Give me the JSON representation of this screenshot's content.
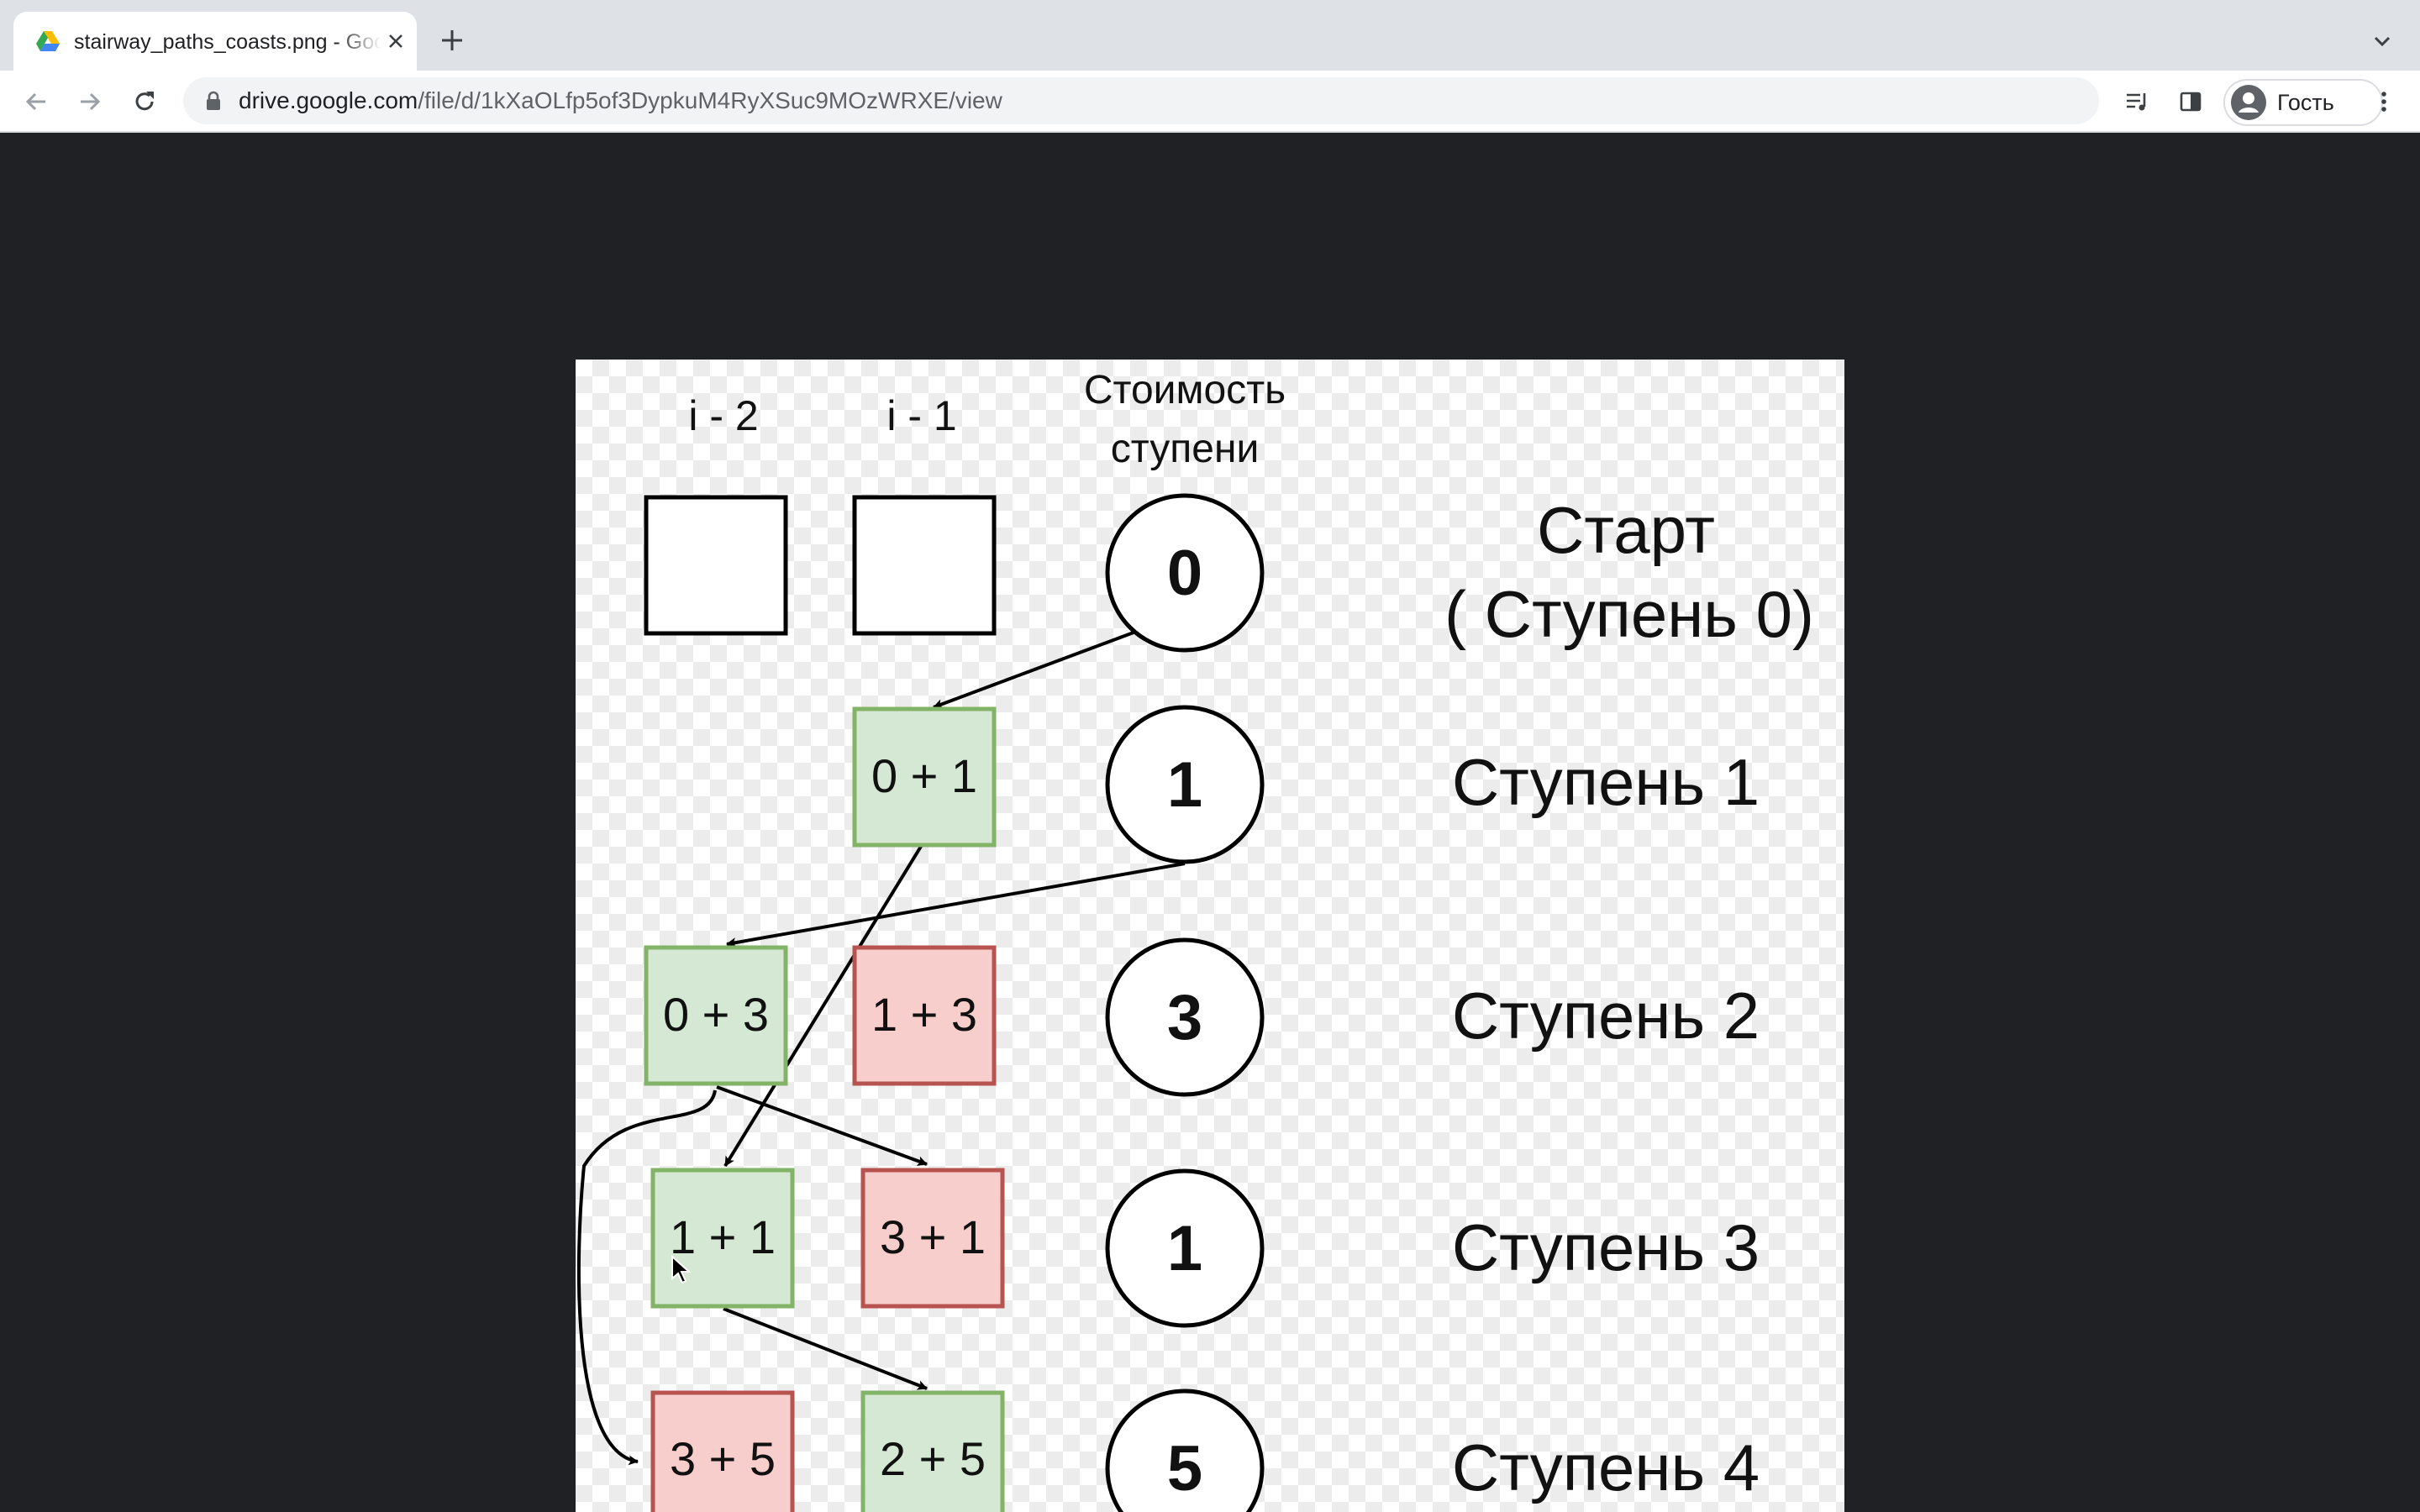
{
  "tab": {
    "title": "stairway_paths_coasts.png - Google Drive"
  },
  "address_bar": {
    "host": "drive.google.com",
    "path": "/file/d/1kXaOLfp5of3DypkuM4RyXSuc9MOzWRXE/view"
  },
  "profile": {
    "name": "Гость"
  },
  "icons": {
    "tab_favicon": "google-drive-icon",
    "tab_close": "close-icon",
    "new_tab": "plus-icon",
    "tab_list": "chevron-down-icon",
    "back": "arrow-left-icon",
    "forward": "arrow-right-icon",
    "reload": "reload-icon",
    "lock": "lock-icon",
    "media": "media-playlist-icon",
    "side_panel": "side-panel-icon",
    "avatar": "person-icon",
    "menu": "kebab-menu-icon"
  },
  "colors": {
    "green_fill": "#d5e8d4",
    "green_stroke": "#82b366",
    "red_fill": "#f8cecc",
    "red_stroke": "#b85450"
  },
  "diagram": {
    "headers": {
      "col_i2": "i - 2",
      "col_i1": "i - 1",
      "cost_line1": "Стоимость",
      "cost_line2": "ступени"
    },
    "rows": [
      {
        "cost": "0",
        "label_line1": "Старт",
        "label_line2": "( Ступень 0)",
        "box_i2": "",
        "box_i1": ""
      },
      {
        "cost": "1",
        "label": "Ступень 1",
        "box_i1": "0 + 1"
      },
      {
        "cost": "3",
        "label": "Ступень 2",
        "box_i2": "0 + 3",
        "box_i1": "1 + 3"
      },
      {
        "cost": "1",
        "label": "Ступень 3",
        "box_i2": "1 + 1",
        "box_i1": "3 + 1"
      },
      {
        "cost": "5",
        "label": "Ступень 4",
        "box_i2": "3 + 5",
        "box_i1": "2 + 5"
      }
    ]
  }
}
